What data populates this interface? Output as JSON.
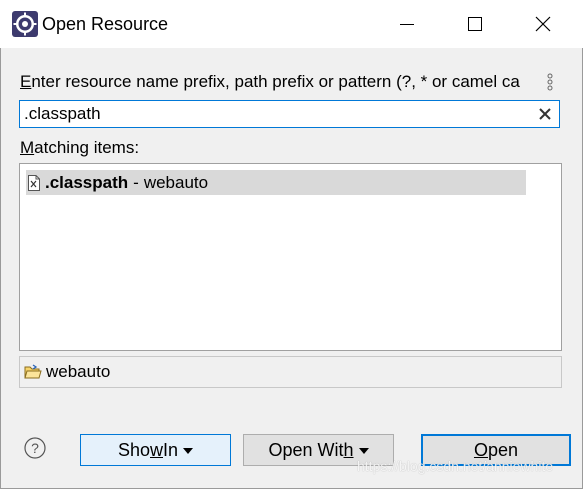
{
  "window": {
    "title": "Open Resource"
  },
  "form": {
    "prompt_pre": "E",
    "prompt_rest": "nter resource name prefix, path prefix or pattern (?, * or camel ca",
    "search_value": ".classpath",
    "matching_pre": "M",
    "matching_rest": "atching items:"
  },
  "results": [
    {
      "name": ".classpath",
      "separator": "-",
      "project": "webauto"
    }
  ],
  "status": {
    "text": "webauto"
  },
  "buttons": {
    "show_in_pre": "Sho",
    "show_in_ul": "w",
    "show_in_post": " In",
    "open_with_pre": "Open Wit",
    "open_with_ul": "h",
    "open_ul": "O",
    "open_rest": "pen"
  },
  "watermark": "https://blog.csdn.net/anniewhite",
  "colors": {
    "accent": "#0078d7",
    "selection": "#d9d9d9"
  },
  "icons": [
    "app-icon",
    "minimize-icon",
    "maximize-icon",
    "close-icon",
    "menu-kebab-icon",
    "clear-icon",
    "file-icon",
    "folder-icon",
    "help-icon",
    "dropdown-caret-icon"
  ]
}
